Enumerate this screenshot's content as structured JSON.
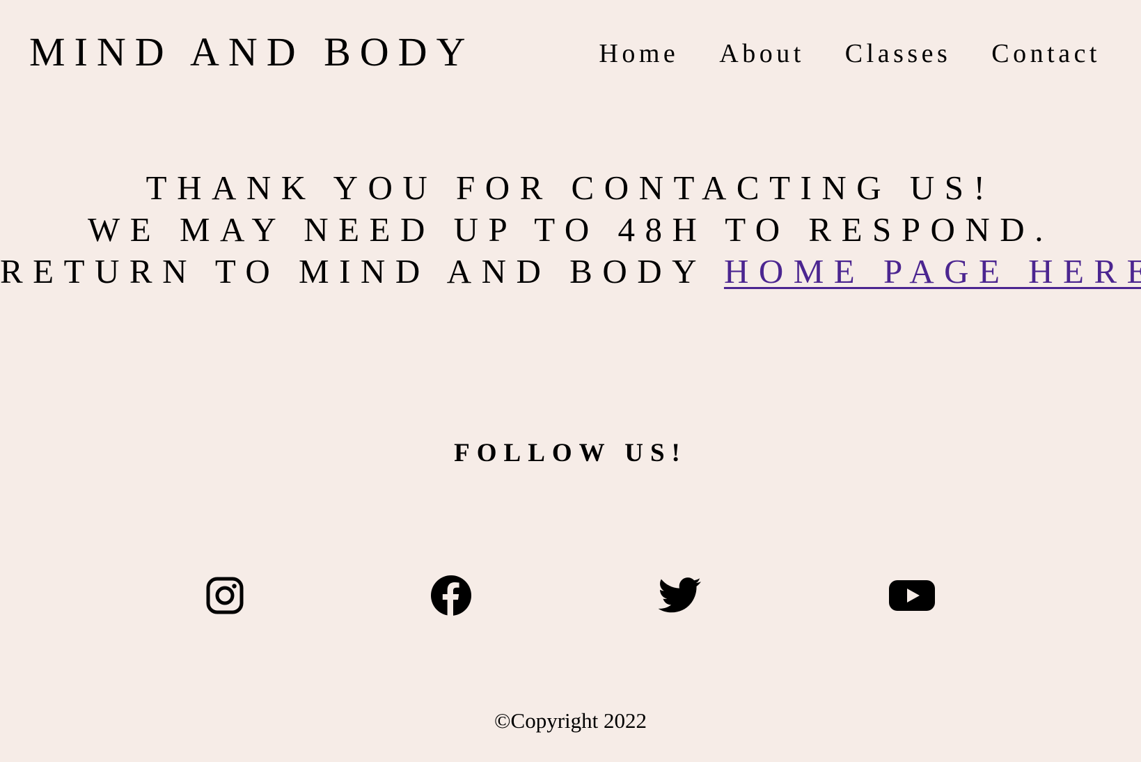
{
  "header": {
    "logo": "MIND AND BODY",
    "nav": [
      {
        "label": "Home"
      },
      {
        "label": "About"
      },
      {
        "label": "Classes"
      },
      {
        "label": "Contact"
      }
    ]
  },
  "message": {
    "line1": "THANK YOU FOR CONTACTING US!",
    "line2": "WE MAY NEED UP TO 48H TO RESPOND.",
    "line3_prefix": "RETURN TO MIND AND BODY ",
    "line3_link": "HOME PAGE HERE",
    "line3_suffix": "!"
  },
  "follow": {
    "heading": "FOLLOW US!",
    "icons": [
      "instagram-icon",
      "facebook-icon",
      "twitter-icon",
      "youtube-icon"
    ]
  },
  "footer": {
    "copyright": "©Copyright 2022"
  },
  "colors": {
    "background": "#f6ece7",
    "text": "#000000",
    "link": "#4b2590"
  }
}
